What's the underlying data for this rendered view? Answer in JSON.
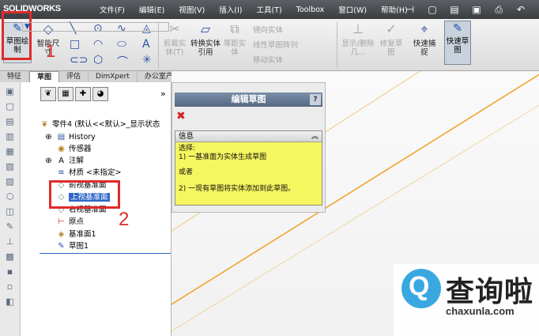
{
  "app": {
    "logo": "SOLIDWORKS"
  },
  "menu": [
    "文件(F)",
    "编辑(E)",
    "视图(V)",
    "插入(I)",
    "工具(T)",
    "Toolbox",
    "窗口(W)",
    "帮助(H)"
  ],
  "ribbon": {
    "sketch": "草图绘制",
    "smart_dim": "智能尺寸",
    "cut_entities": "剪裁实体(T)",
    "convert_entities": "转换实体引用",
    "offset_entities": "等距实体",
    "mirror_entities": "镜向实体",
    "linear_pattern": "线性草图阵列",
    "move_entities": "移动实体",
    "display_delete": "显示/删除几...",
    "repair_sketch": "修复草图",
    "quick_snaps": "快速捕捉",
    "rapid_sketch": "快速草图"
  },
  "tabs": [
    "特征",
    "草图",
    "评估",
    "DimXpert",
    "办公室产品"
  ],
  "tree": {
    "root": "零件4 (默认<<默认>_显示状态",
    "items": [
      "History",
      "传感器",
      "注解",
      "材质 <未指定>",
      "前视基准面",
      "上视基准面",
      "右视基准面",
      "原点",
      "基准面1",
      "草图1"
    ]
  },
  "property_manager": {
    "title": "编辑草图",
    "help": "?",
    "info_title": "信息",
    "info_lines": [
      "选择:",
      "1) 一基准面为实体生成草图",
      "或者",
      "2) 一现有草图将实体添加到此草图。"
    ]
  },
  "annotations": {
    "one": "1",
    "two": "2"
  },
  "watermark": {
    "text": "查询啦",
    "url": "chaxunla.com",
    "glyph": "Q"
  },
  "colors": {
    "annotation_red": "#e02a2a",
    "selection_blue": "#2f67c8",
    "info_yellow": "#f6f660",
    "sketch_line": "#f0a020"
  }
}
